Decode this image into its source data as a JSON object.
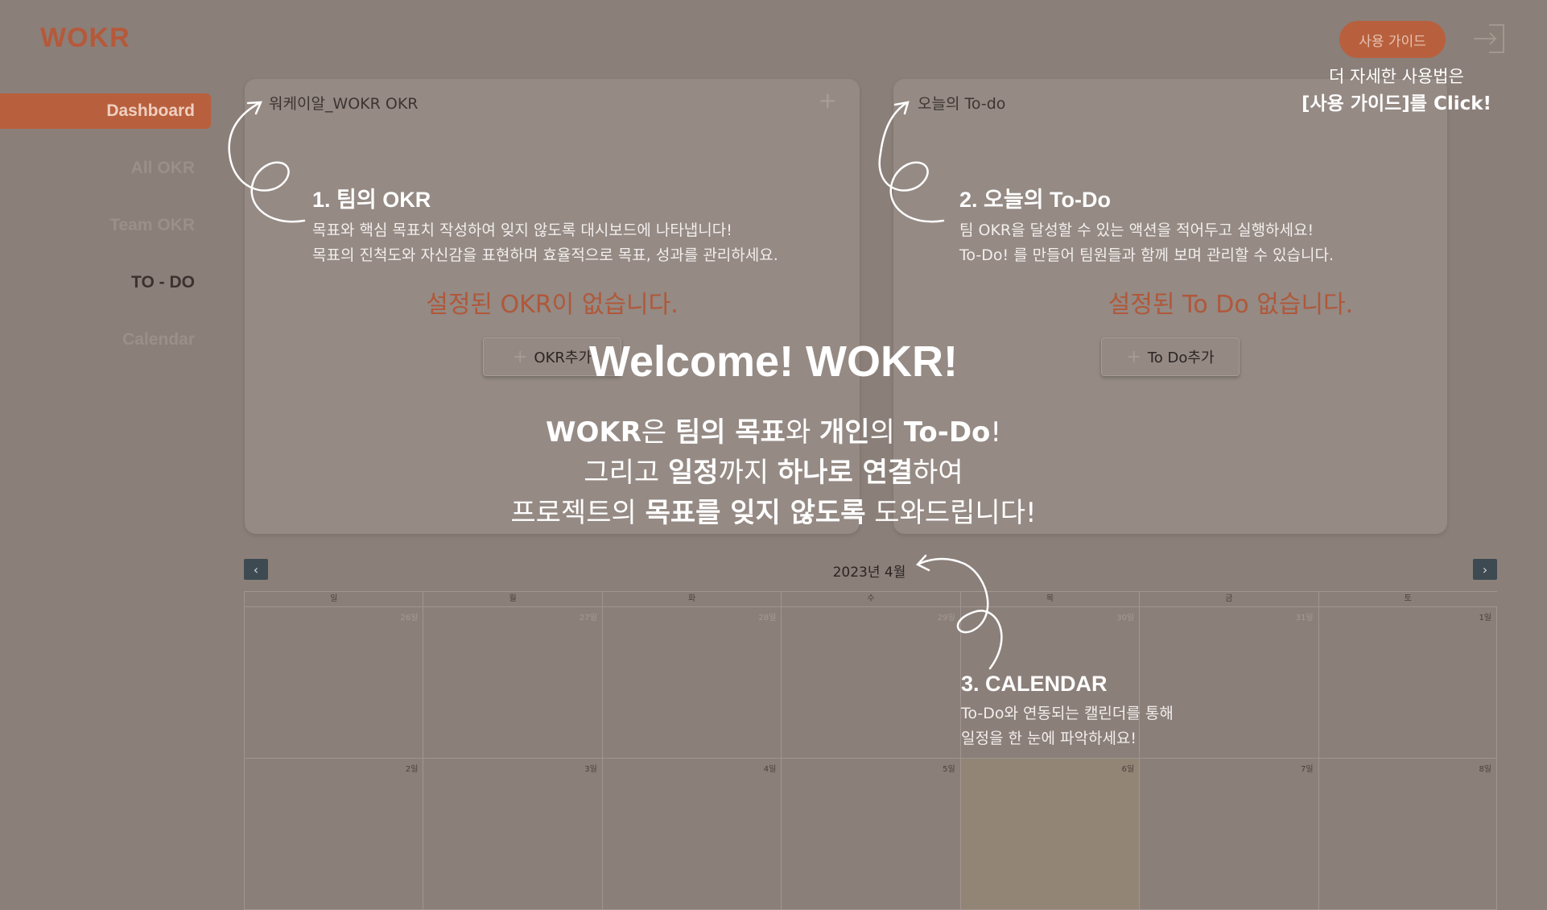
{
  "app": {
    "logo": "WOKR",
    "guide_button": "사용 가이드"
  },
  "sidebar": {
    "items": [
      {
        "label": "Dashboard",
        "active": true
      },
      {
        "label": "All OKR"
      },
      {
        "label": "Team OKR"
      },
      {
        "label": "TO - DO"
      },
      {
        "label": "Calendar"
      }
    ]
  },
  "okr_card": {
    "title": "워케이알_WOKR OKR",
    "empty": "설정된 OKR이 없습니다.",
    "add_button": "OKR추가"
  },
  "todo_card": {
    "title": "오늘의 To-do",
    "empty": "설정된 To Do 없습니다.",
    "add_button": "To Do추가"
  },
  "calendar": {
    "title": "2023년 4월",
    "weekdays": [
      "일",
      "월",
      "화",
      "수",
      "목",
      "금",
      "토"
    ],
    "week1": [
      "26일",
      "27일",
      "28일",
      "29일",
      "30일",
      "31일",
      "1일"
    ],
    "week2": [
      "2일",
      "3일",
      "4일",
      "5일",
      "6일",
      "7일",
      "8일"
    ]
  },
  "overlay": {
    "welcome": "Welcome! WOKR!",
    "line1": {
      "a": "WOKR",
      "b": "은 ",
      "c": "팀의 목표",
      "d": "와 ",
      "e": "개인",
      "f": "의 ",
      "g": "To-Do",
      "h": "!"
    },
    "line2": {
      "a": "그리고 ",
      "b": "일정",
      "c": "까지 ",
      "d": "하나로 연결",
      "e": "하여"
    },
    "line3": {
      "a": "프로젝트의 ",
      "b": "목표를 잊지 않도록",
      "c": " 도와드립니다!"
    },
    "guide_hint": {
      "line1": "더 자세한 사용법은",
      "line2": "[사용 가이드]를 Click!"
    },
    "sections": [
      {
        "title": "1. 팀의 OKR",
        "desc1": "목표와 핵심 목표치 작성하여 잊지 않도록 대시보드에 나타냅니다!",
        "desc2": "목표의 진척도와 자신감을 표현하며 효율적으로 목표, 성과를 관리하세요."
      },
      {
        "title": "2. 오늘의 To-Do",
        "desc1": "팀 OKR을 달성할 수 있는 액션을 적어두고 실행하세요!",
        "desc2": "To-Do! 를 만들어 팀원들과 함께 보며 관리할 수 있습니다."
      },
      {
        "title": "3. CALENDAR",
        "desc1": "To-Do와 연동되는 캘린더를 통해",
        "desc2": "일정을 한 눈에 파악하세요!"
      }
    ]
  }
}
